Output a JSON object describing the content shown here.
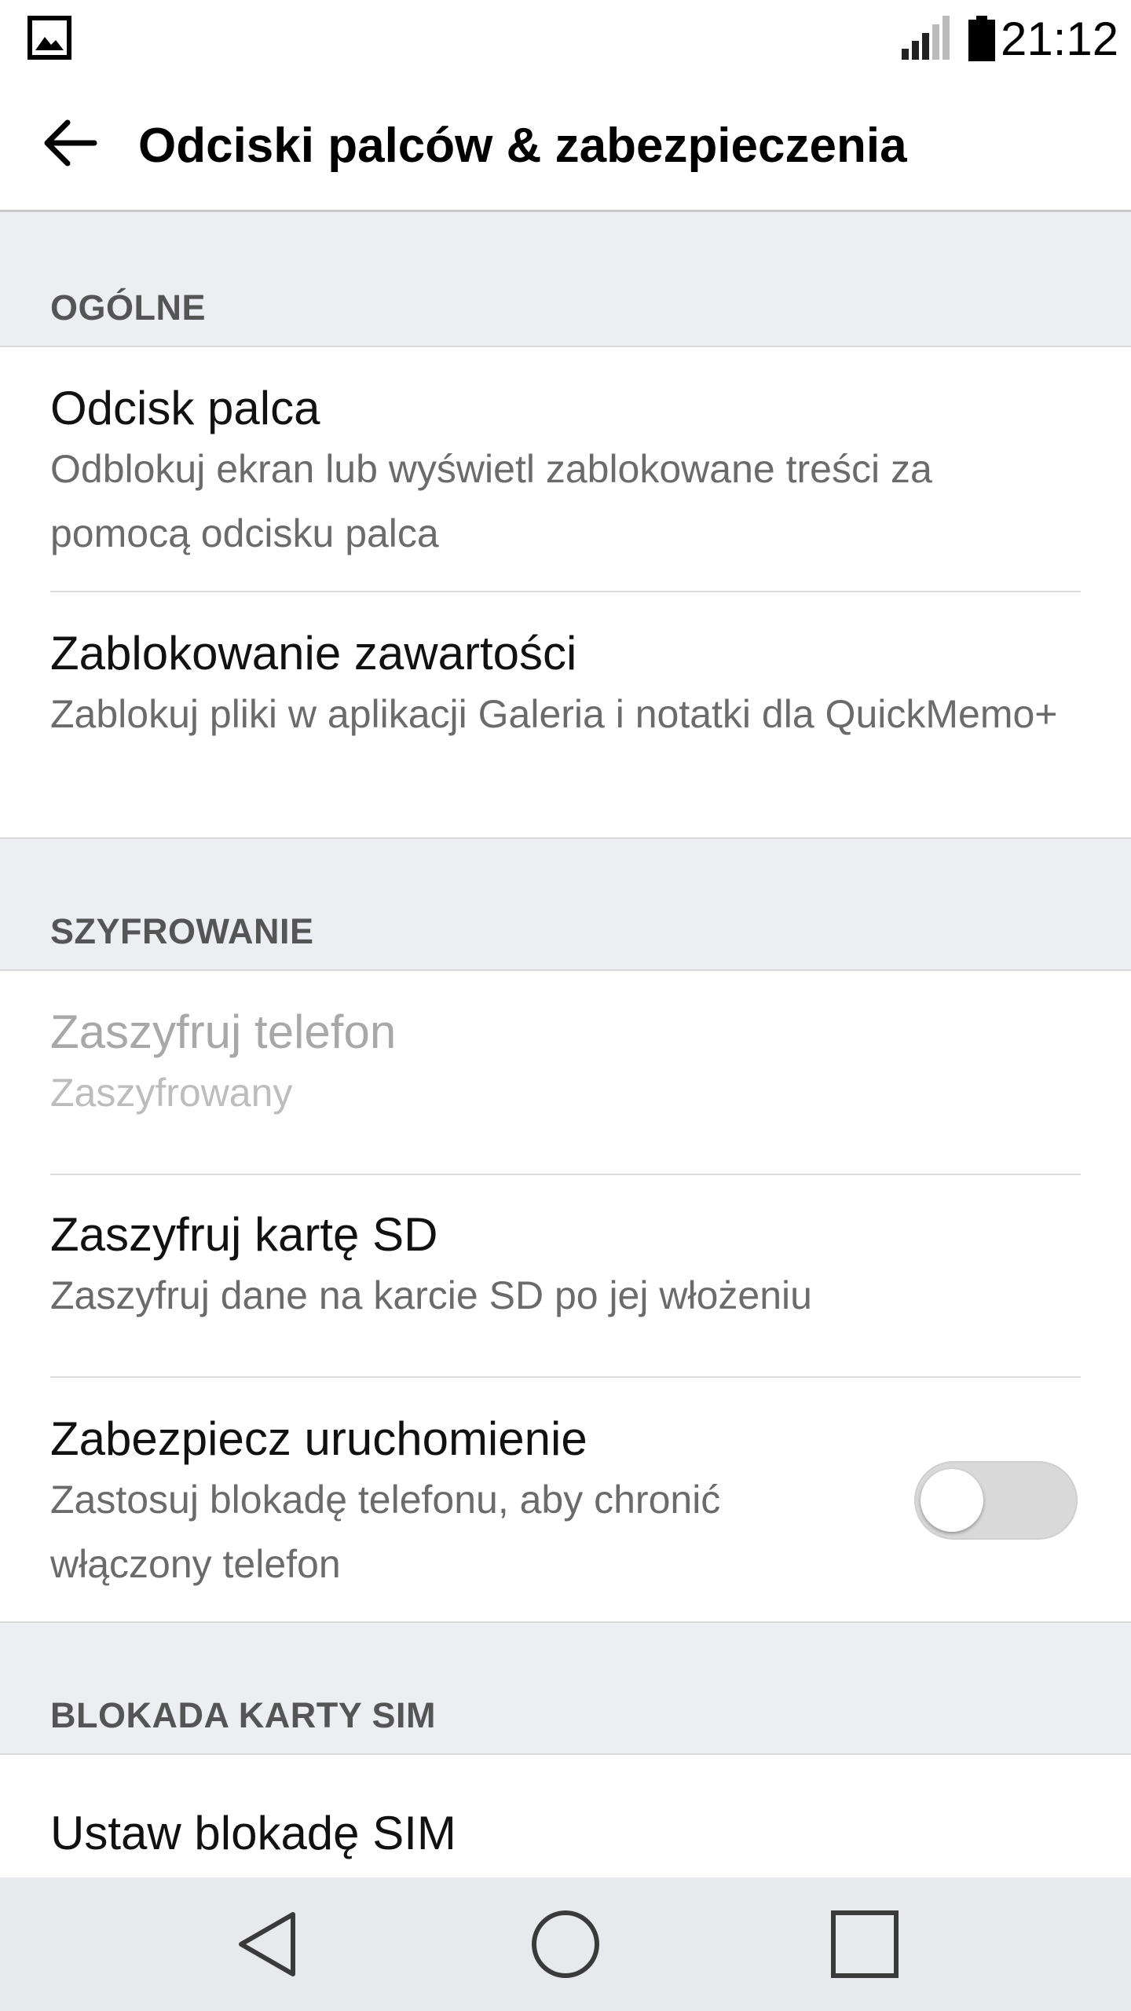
{
  "status_bar": {
    "time": "21:12",
    "icons": [
      "gallery-icon",
      "signal-icon",
      "battery-icon"
    ]
  },
  "app_bar": {
    "back_icon": "arrow-back-icon",
    "title": "Odciski palców & zabezpieczenia"
  },
  "sections": [
    {
      "header": "OGÓLNE",
      "items": [
        {
          "title": "Odcisk palca",
          "subtitle": "Odblokuj ekran lub wyświetl zablokowane treści za pomocą odcisku palca"
        },
        {
          "title": "Zablokowanie zawartości",
          "subtitle": "Zablokuj pliki w aplikacji Galeria i notatki dla QuickMemo+"
        }
      ]
    },
    {
      "header": "SZYFROWANIE",
      "items": [
        {
          "title": "Zaszyfruj telefon",
          "subtitle": "Zaszyfrowany",
          "enabled": false
        },
        {
          "title": "Zaszyfruj kartę SD",
          "subtitle": "Zaszyfruj dane na karcie SD po jej włożeniu"
        },
        {
          "title": "Zabezpiecz uruchomienie",
          "subtitle": "Zastosuj blokadę telefonu, aby chronić włączony telefon",
          "toggle": false
        }
      ]
    },
    {
      "header": "BLOKADA KARTY SIM",
      "items": [
        {
          "title": "Ustaw blokadę SIM"
        }
      ]
    }
  ],
  "nav_bar": {
    "buttons": [
      "back-triangle-icon",
      "home-circle-icon",
      "recents-square-icon"
    ]
  },
  "colors": {
    "section_background": "#eceef2",
    "section_text": "#555555",
    "subtitle_text": "#6b6b6b",
    "disabled_text": "#a8a8a8",
    "toggle_off": "#d9d9d9",
    "nav_bar_background": "#e8e9ec"
  }
}
